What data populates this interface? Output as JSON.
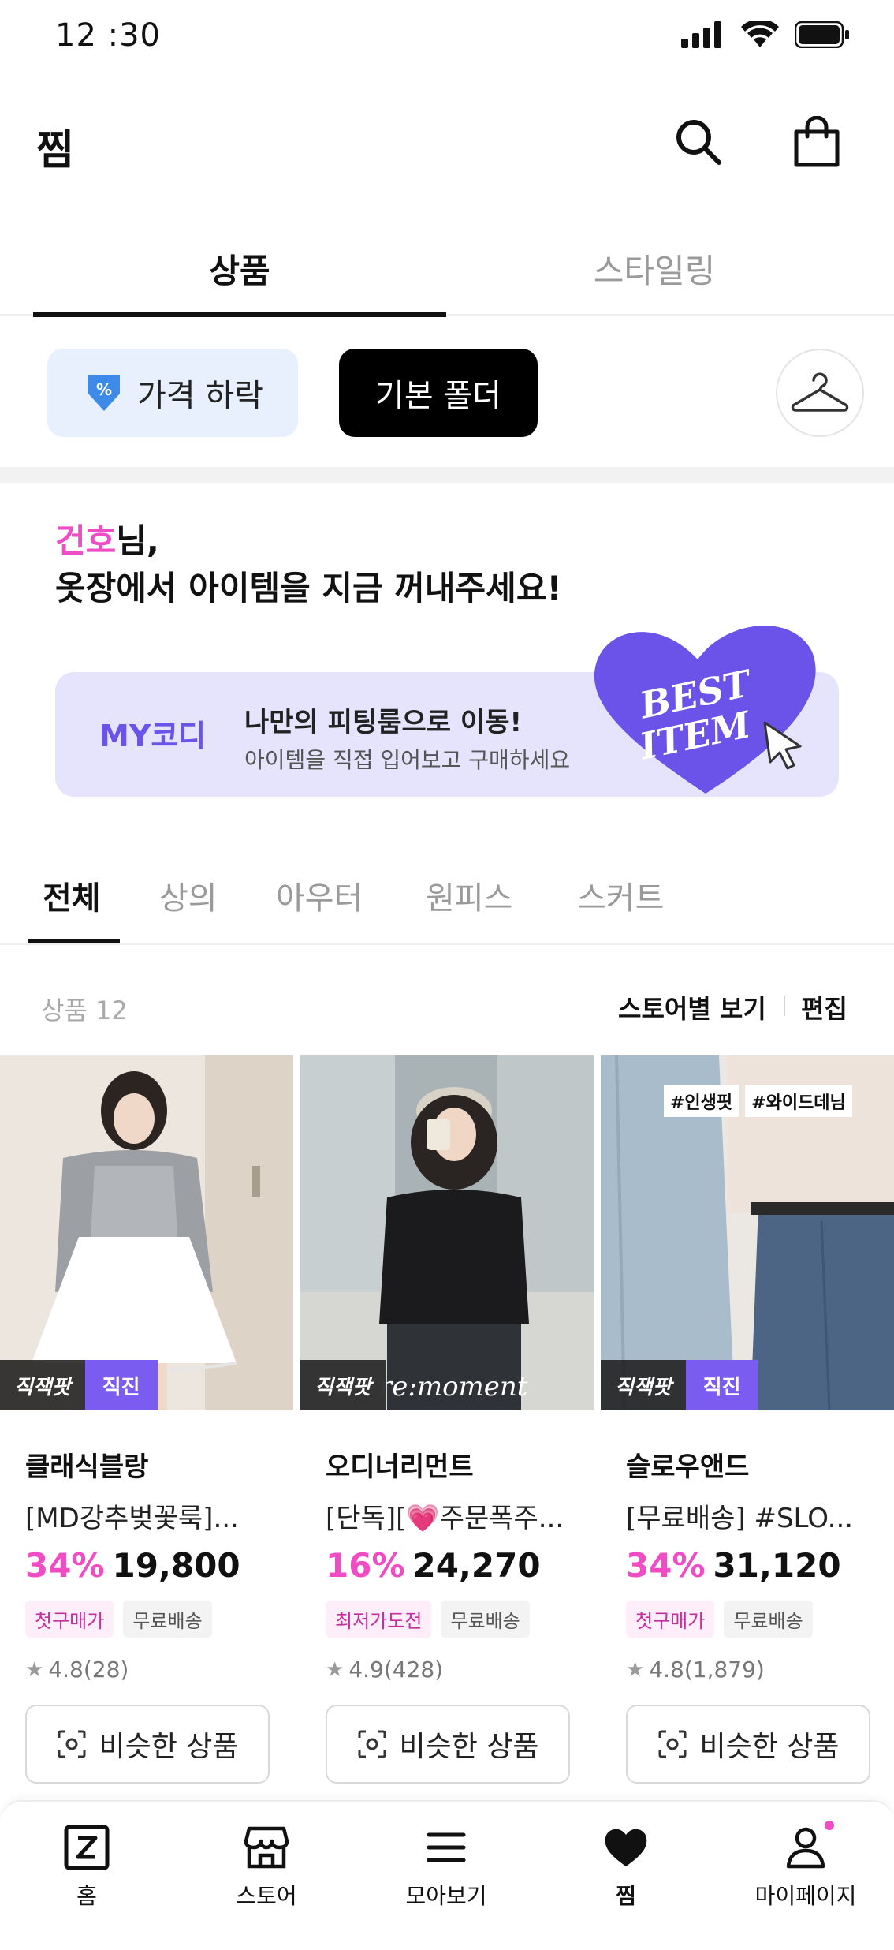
{
  "status_bar": {
    "time": "12 :30"
  },
  "header": {
    "title": "찜",
    "search_icon": "search-icon",
    "cart_icon": "shopping-bag-icon"
  },
  "main_tabs": [
    {
      "label": "상품",
      "active": true
    },
    {
      "label": "스타일링",
      "active": false
    }
  ],
  "folders": {
    "price_drop": "가격 하락",
    "default_folder": "기본 폴더",
    "closet_icon": "hanger-icon"
  },
  "greeting": {
    "name": "건호",
    "suffix": "님,",
    "line2": "옷장에서 아이템을 지금 꺼내주세요!"
  },
  "banner": {
    "brand": "MY코디",
    "title": "나만의 피팅룸으로 이동!",
    "subtitle": "아이템을 직접 입어보고 구매하세요",
    "heart_text_1": "BEST",
    "heart_text_2": "ITEM",
    "heart_color": "#6b52e8"
  },
  "category_tabs": [
    {
      "label": "전체",
      "active": true
    },
    {
      "label": "상의",
      "active": false
    },
    {
      "label": "아우터",
      "active": false
    },
    {
      "label": "원피스",
      "active": false
    },
    {
      "label": "스커트",
      "active": false
    }
  ],
  "list_header": {
    "count": "상품 12",
    "store_view": "스토어별 보기",
    "edit": "편집"
  },
  "products": [
    {
      "brand": "클래식블랑",
      "title": "[MD강추벚꽃룩]...",
      "discount": "34%",
      "price": "19,800",
      "tags": [
        {
          "text": "첫구매가",
          "style": "pink"
        },
        {
          "text": "무료배송",
          "style": "gray"
        }
      ],
      "rating": "4.8(28)",
      "badge_left": "직잭팟",
      "badge_right": "직진",
      "similar": "비슷한 상품"
    },
    {
      "brand": "오디너리먼트",
      "title": "[단독][💗주문폭주...",
      "discount": "16%",
      "price": "24,270",
      "tags": [
        {
          "text": "최저가도전",
          "style": "pink"
        },
        {
          "text": "무료배송",
          "style": "gray"
        }
      ],
      "rating": "4.9(428)",
      "badge_left": "직잭팟",
      "image_caption": "re:moment",
      "similar": "비슷한 상품"
    },
    {
      "brand": "슬로우앤드",
      "title": "[무료배송] #SLO...",
      "discount": "34%",
      "price": "31,120",
      "tags": [
        {
          "text": "첫구매가",
          "style": "pink"
        },
        {
          "text": "무료배송",
          "style": "gray"
        }
      ],
      "rating": "4.8(1,879)",
      "badge_left": "직잭팟",
      "badge_right": "직진",
      "hashtags": [
        "#인생핏",
        "#와이드데님"
      ],
      "similar": "비슷한 상품"
    }
  ],
  "bottom_nav": [
    {
      "label": "홈",
      "icon": "home-z-icon",
      "active": false
    },
    {
      "label": "스토어",
      "icon": "store-icon",
      "active": false
    },
    {
      "label": "모아보기",
      "icon": "menu-icon",
      "active": false
    },
    {
      "label": "찜",
      "icon": "heart-icon",
      "active": true
    },
    {
      "label": "마이페이지",
      "icon": "user-icon",
      "active": false
    }
  ],
  "colors": {
    "accent_pink": "#f04dc4",
    "accent_purple": "#6b52e8",
    "price_chip_bg": "#e7f0fc"
  }
}
